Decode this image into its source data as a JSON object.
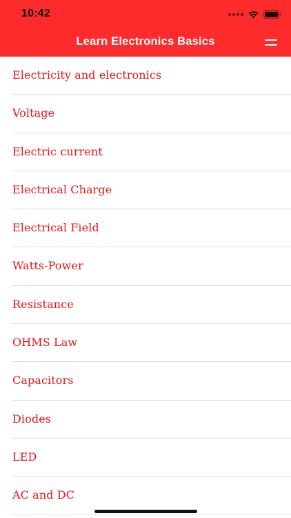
{
  "status_bar": {
    "time": "10:42"
  },
  "nav": {
    "title": "Learn Electronics Basics",
    "menu_icon": "hamburger-menu-icon"
  },
  "colors": {
    "accent": "#fd2b2c",
    "item_text": "#e8141a",
    "separator": "#dedede"
  },
  "topics": [
    {
      "label": "Electricity and electronics"
    },
    {
      "label": "Voltage"
    },
    {
      "label": "Electric current"
    },
    {
      "label": "Electrical Charge"
    },
    {
      "label": "Electrical Field"
    },
    {
      "label": "Watts-Power"
    },
    {
      "label": "Resistance"
    },
    {
      "label": "OHMS Law"
    },
    {
      "label": "Capacitors"
    },
    {
      "label": "Diodes"
    },
    {
      "label": "LED"
    },
    {
      "label": "AC and DC"
    }
  ]
}
